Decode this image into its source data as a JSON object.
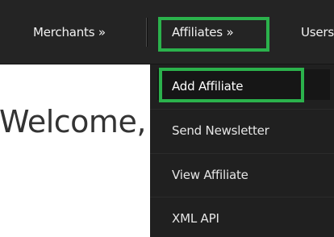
{
  "nav": {
    "merchants_label": "Merchants »",
    "affiliates_label": "Affiliates »",
    "users_label": "Users"
  },
  "main": {
    "welcome_text": "Welcome, Admin"
  },
  "dropdown": {
    "items": [
      {
        "label": "Add Affiliate"
      },
      {
        "label": "Send Newsletter"
      },
      {
        "label": "View Affiliate"
      },
      {
        "label": "XML API"
      }
    ]
  },
  "colors": {
    "navbar_bg": "#242424",
    "dropdown_bg": "#202020",
    "highlight_green": "#2bb24c",
    "text_light": "#f2f2f2",
    "text_dark": "#333333"
  }
}
